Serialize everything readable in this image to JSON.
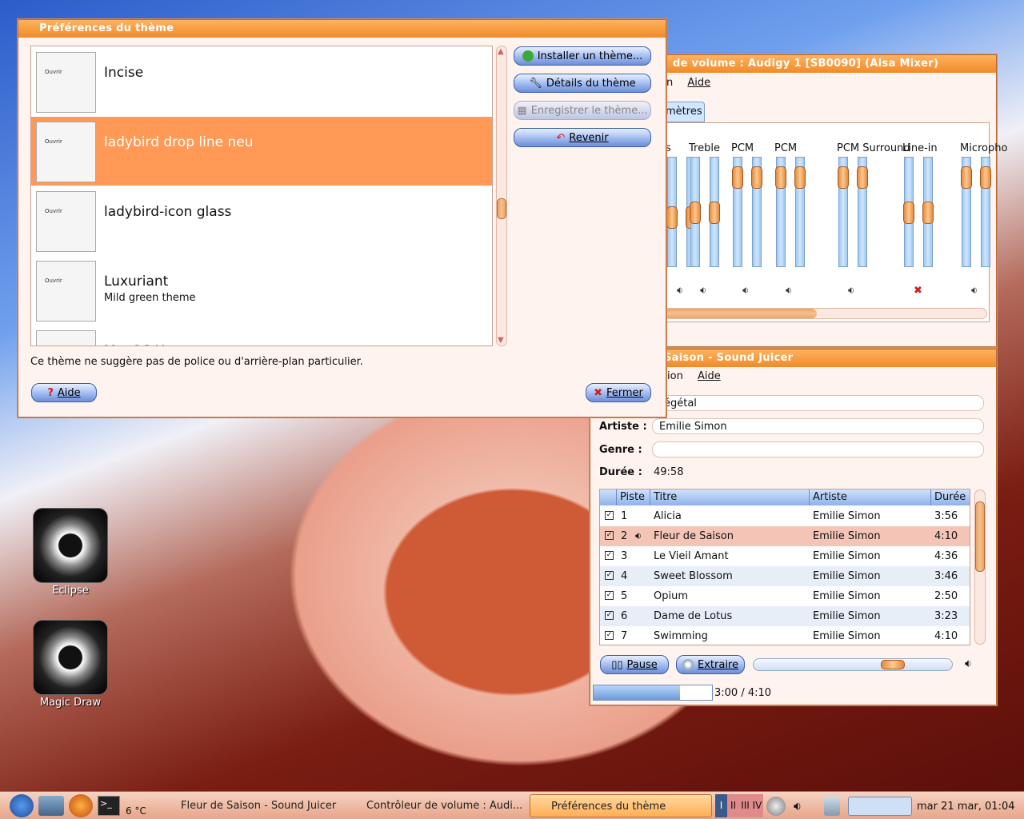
{
  "theme_window": {
    "title": "Préférences du thème",
    "themes": [
      {
        "name": "Incise",
        "desc": ""
      },
      {
        "name": "ladybird drop line neu",
        "desc": ""
      },
      {
        "name": "ladybird-icon glass",
        "desc": ""
      },
      {
        "name": "Luxuriant",
        "desc": "Mild green theme"
      },
      {
        "name": "MacOS X",
        "desc": ""
      }
    ],
    "thumb_label": "Ouvrir",
    "buttons": {
      "install": "Installer un thème...",
      "details": "Détails du thème",
      "save": "Enregistrer le thème...",
      "revert": "Revenir",
      "help": "Aide",
      "close": "Fermer"
    },
    "info_text": "Ce thème ne suggère pas de police ou d'arrière-plan particulier."
  },
  "mixer_window": {
    "title": "de volume : Audigy 1 [SB0090] (Alsa Mixer)",
    "menu": [
      "n",
      "Aide"
    ],
    "tab": "mètres",
    "channels": [
      {
        "name": "s",
        "level": 0.45
      },
      {
        "name": "Treble",
        "level": 0.5
      },
      {
        "name": "PCM",
        "level": 0.9
      },
      {
        "name": "PCM",
        "level": 0.9
      },
      {
        "name": "PCM Surround",
        "level": 0.9
      },
      {
        "name": "Line-in",
        "level": 0.5,
        "muted": true
      },
      {
        "name": "Micropho",
        "level": 0.9
      }
    ]
  },
  "juicer_window": {
    "title": "Saison - Sound Juicer",
    "menu": [
      "ion",
      "Aide"
    ],
    "album_value": "égétal",
    "artist_label": "Artiste :",
    "artist_value": "Emilie Simon",
    "genre_label": "Genre :",
    "genre_value": "",
    "duration_label": "Durée :",
    "duration_value": "49:58",
    "columns": [
      "Piste",
      "Titre",
      "Artiste",
      "Durée"
    ],
    "tracks": [
      {
        "n": "1",
        "title": "Alicia",
        "artist": "Emilie Simon",
        "dur": "3:56"
      },
      {
        "n": "2",
        "title": "Fleur de Saison",
        "artist": "Emilie Simon",
        "dur": "4:10"
      },
      {
        "n": "3",
        "title": "Le Vieil Amant",
        "artist": "Emilie Simon",
        "dur": "4:36"
      },
      {
        "n": "4",
        "title": "Sweet Blossom",
        "artist": "Emilie Simon",
        "dur": "3:46"
      },
      {
        "n": "5",
        "title": "Opium",
        "artist": "Emilie Simon",
        "dur": "2:50"
      },
      {
        "n": "6",
        "title": "Dame de Lotus",
        "artist": "Emilie Simon",
        "dur": "3:23"
      },
      {
        "n": "7",
        "title": "Swimming",
        "artist": "Emilie Simon",
        "dur": "4:10"
      }
    ],
    "pause_label": "Pause",
    "extract_label": "Extraire",
    "time": "3:00 / 4:10",
    "progress": 0.73
  },
  "desktop": {
    "icons": [
      "Eclipse",
      "Magic Draw"
    ]
  },
  "taskbar": {
    "weather": "6 °C",
    "tasks": [
      "Fleur de Saison - Sound Juicer",
      "Contrôleur de volume : Audi...",
      "Préférences du thème"
    ],
    "workspaces": [
      "I",
      "II",
      "III",
      "IV"
    ],
    "clock": "mar 21 mar, 01:04"
  },
  "colors": {
    "accent": "#ff9955",
    "titlebar": "#f08a2a",
    "button": "#9fbaf0"
  }
}
